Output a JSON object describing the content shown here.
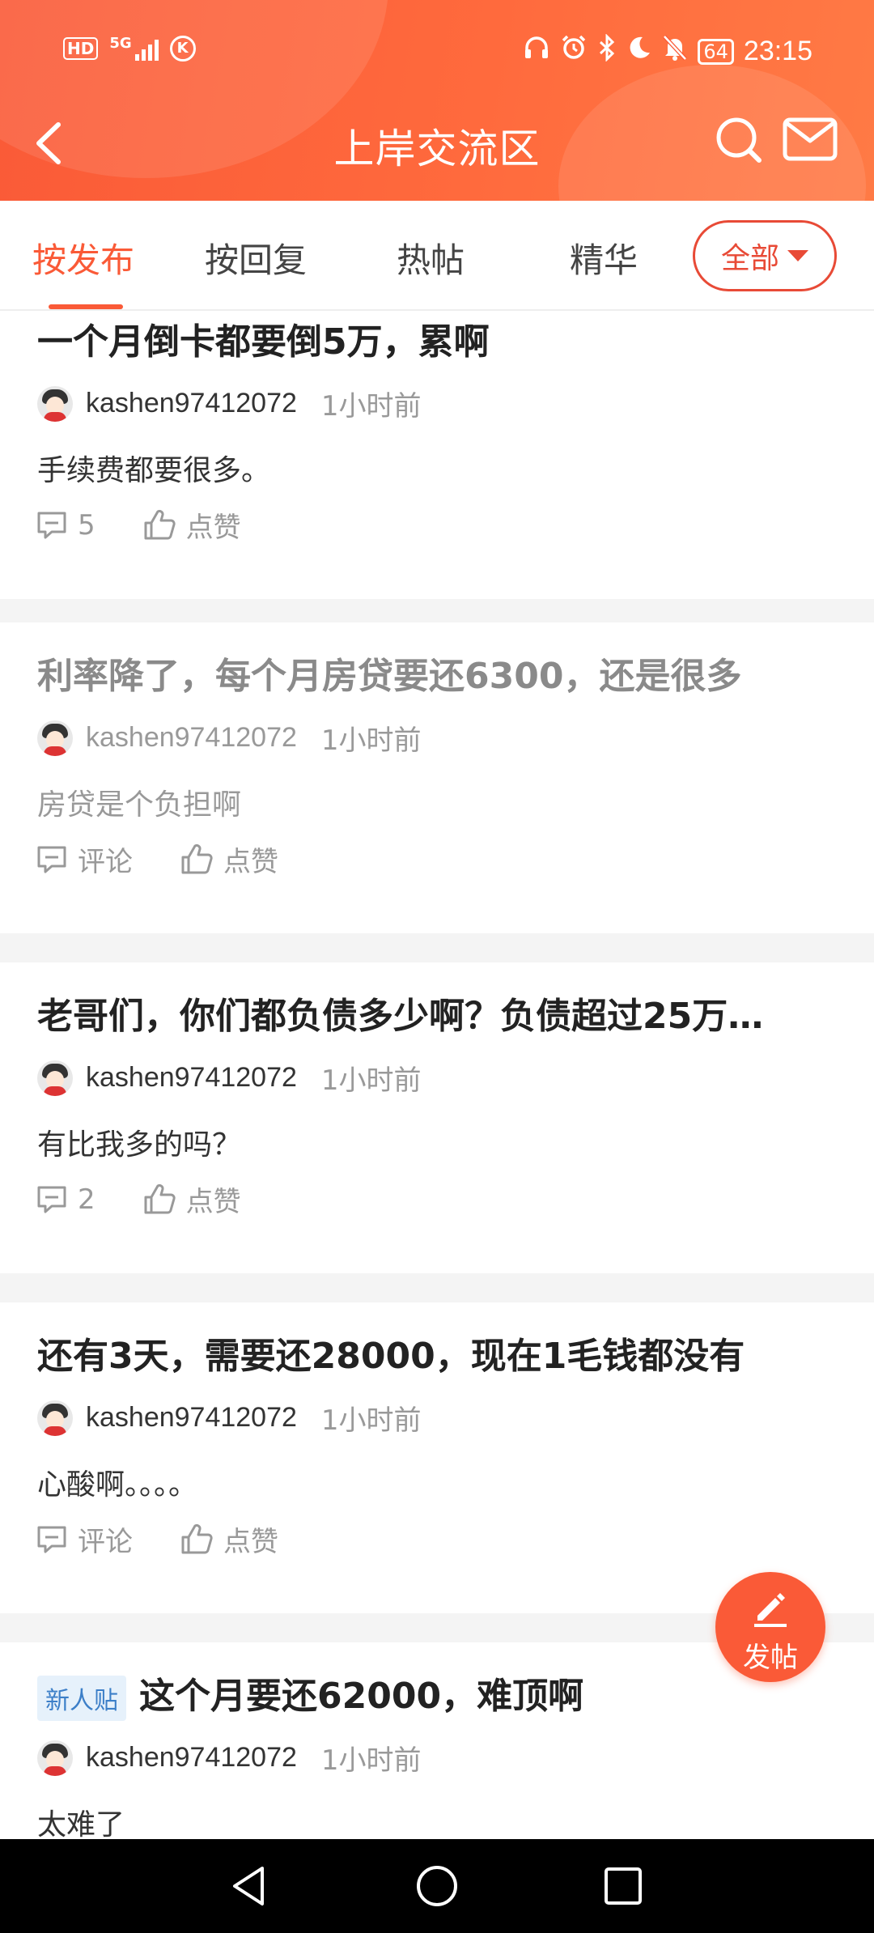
{
  "status_bar": {
    "hd": "HD",
    "network": "5G",
    "k": "K",
    "battery": "64",
    "time": "23:15"
  },
  "nav": {
    "title": "上岸交流区"
  },
  "tabs": [
    {
      "label": "按发布",
      "active": true
    },
    {
      "label": "按回复",
      "active": false
    },
    {
      "label": "热帖",
      "active": false
    },
    {
      "label": "精华",
      "active": false
    }
  ],
  "filter": {
    "label": "全部"
  },
  "posts": [
    {
      "title": "一个月倒卡都要倒5万，累啊",
      "author": "kashen97412072",
      "time": "1小时前",
      "body": "手续费都要很多。",
      "comments": "5",
      "like_label": "点赞",
      "read": false
    },
    {
      "title": "利率降了，每个月房贷要还6300，还是很多",
      "author": "kashen97412072",
      "time": "1小时前",
      "body": "房贷是个负担啊",
      "comments": "评论",
      "like_label": "点赞",
      "read": true
    },
    {
      "title": "老哥们，你们都负债多少啊？负债超过25万…",
      "author": "kashen97412072",
      "time": "1小时前",
      "body": "有比我多的吗？",
      "comments": "2",
      "like_label": "点赞",
      "read": false
    },
    {
      "title": "还有3天，需要还28000，现在1毛钱都没有",
      "author": "kashen97412072",
      "time": "1小时前",
      "body": "心酸啊。。。。",
      "comments": "评论",
      "like_label": "点赞",
      "read": false
    },
    {
      "badge": "新人贴",
      "title": "这个月要还62000，难顶啊",
      "author": "kashen97412072",
      "time": "1小时前",
      "body": "太难了",
      "read": false
    }
  ],
  "fab": {
    "label": "发帖"
  },
  "colors": {
    "accent": "#fa5a37",
    "badge_bg": "#e6f1fb",
    "badge_text": "#3c7fc8"
  }
}
